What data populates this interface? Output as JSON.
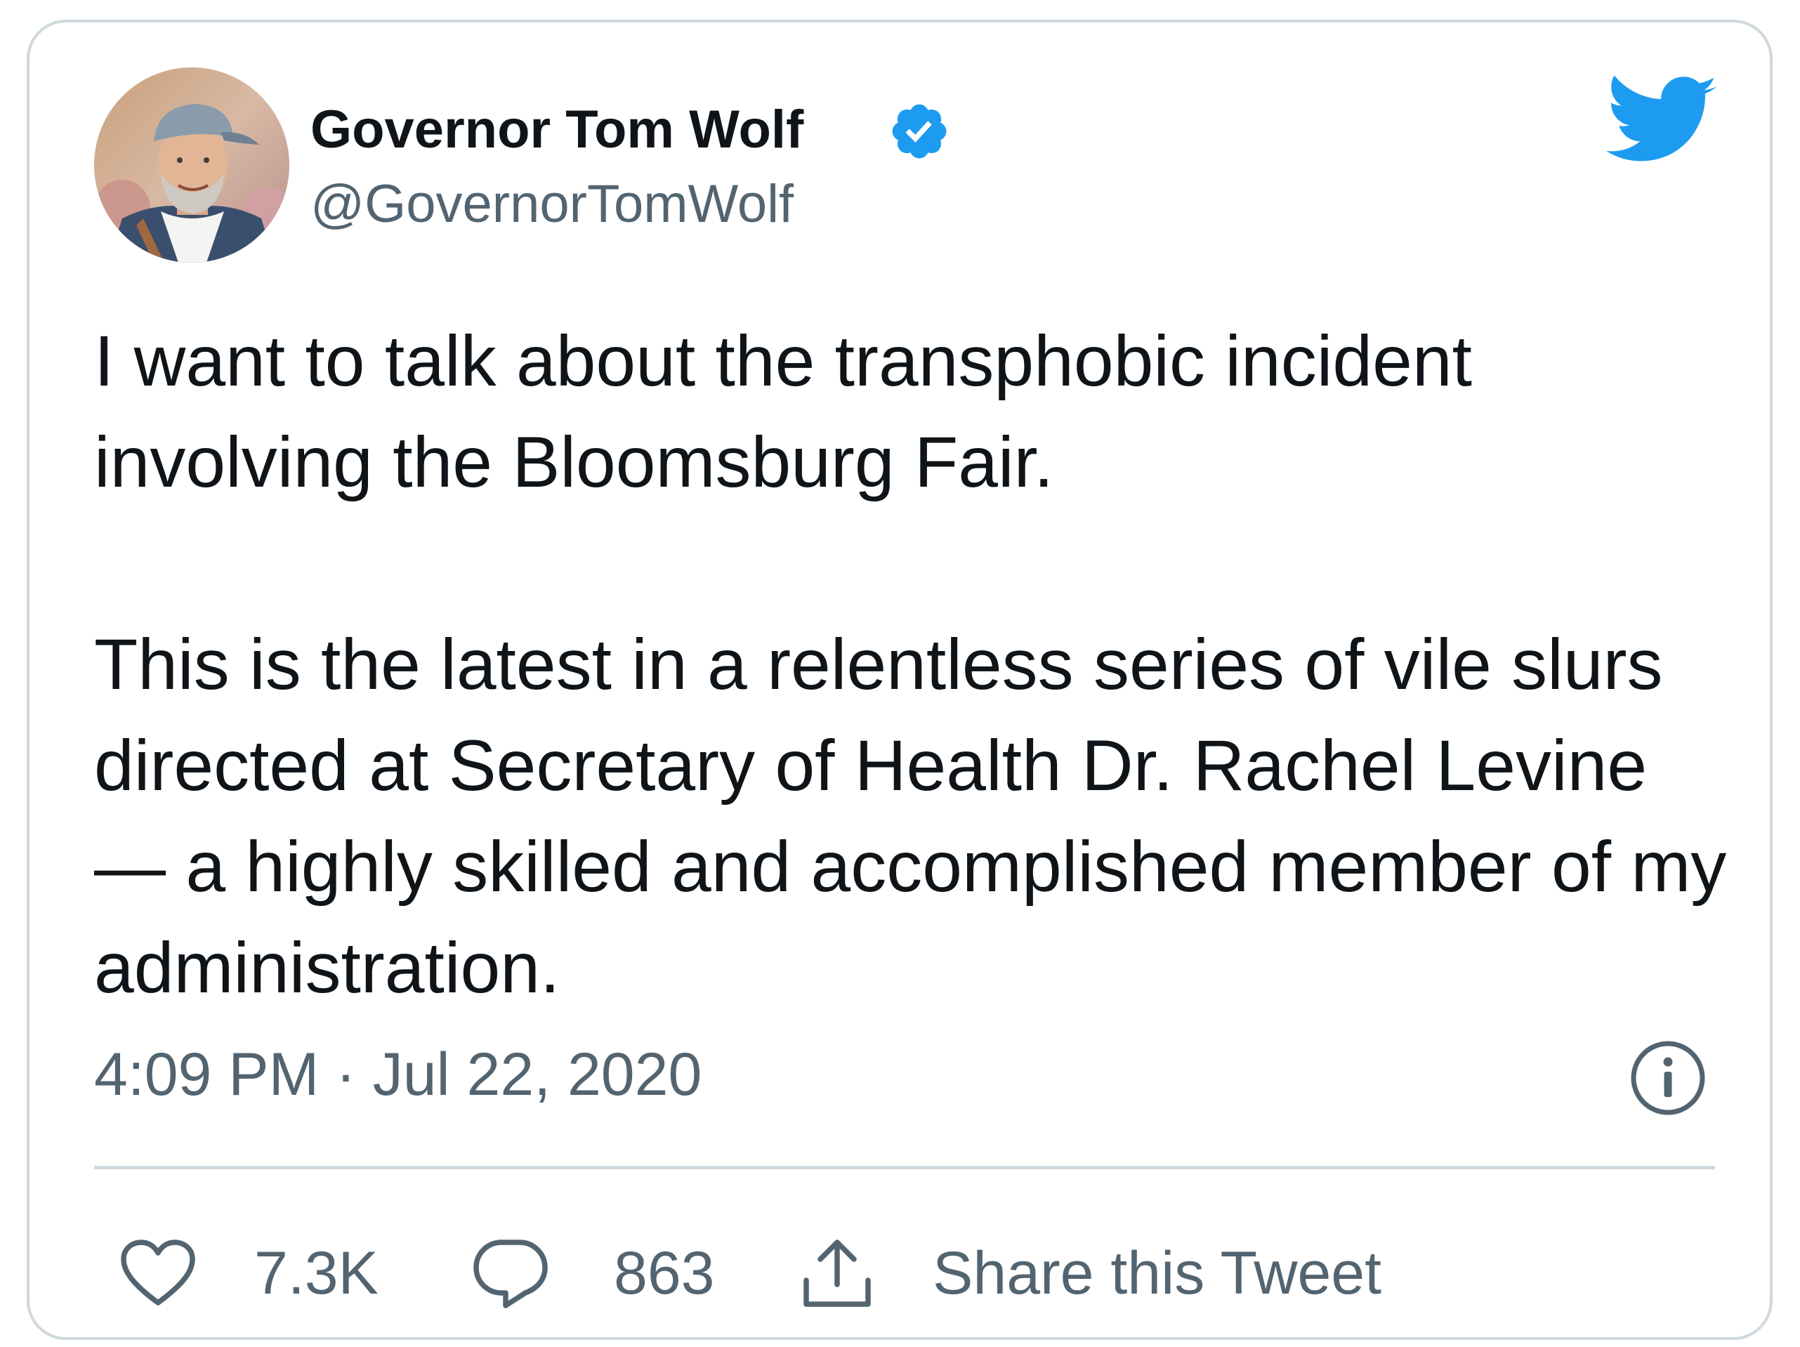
{
  "colors": {
    "text_primary": "#0f1419",
    "text_secondary": "#536471",
    "twitter_blue": "#1d9bf0",
    "border": "#cfd9de"
  },
  "author": {
    "display_name": "Governor Tom Wolf",
    "handle": "@GovernorTomWolf",
    "verified": true,
    "verified_icon": "verified-badge-icon",
    "avatar": "profile-photo-avatar"
  },
  "brand_icon": "twitter-bird-icon",
  "tweet": {
    "text": "I want to talk about the transphobic incident involving the Bloomsburg Fair.\n\nThis is the latest in a relentless series of vile slurs directed at Secretary of Health Dr. Rachel Levine — a highly skilled and accomplished member of my administration.",
    "timestamp": "4:09 PM · Jul 22, 2020",
    "info_icon": "info-icon"
  },
  "actions": {
    "likes": {
      "icon": "heart-icon",
      "count": "7.3K"
    },
    "replies": {
      "icon": "comment-bubble-icon",
      "count": "863"
    },
    "share": {
      "icon": "share-upload-icon",
      "label": "Share this Tweet"
    }
  }
}
